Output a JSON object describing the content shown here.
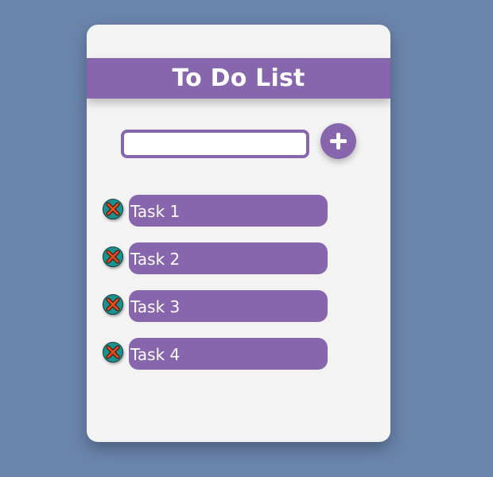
{
  "app": {
    "title": "To Do List"
  },
  "input": {
    "value": "",
    "placeholder": ""
  },
  "add_button": {
    "icon": "plus-icon"
  },
  "tasks": [
    {
      "label": "Task 1",
      "delete_icon": "x-icon"
    },
    {
      "label": "Task 2",
      "delete_icon": "x-icon"
    },
    {
      "label": "Task 3",
      "delete_icon": "x-icon"
    },
    {
      "label": "Task 4",
      "delete_icon": "x-icon"
    }
  ],
  "colors": {
    "background": "#6a84ab",
    "card": "#f3f3f4",
    "accent": "#8766ad",
    "delete_button": "#1c8f8f",
    "delete_x": "#e04a1c"
  }
}
